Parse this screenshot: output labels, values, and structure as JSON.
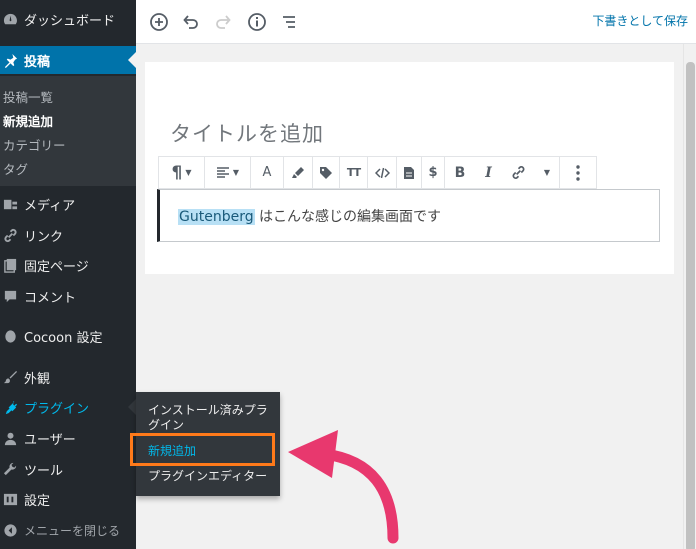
{
  "sidebar": {
    "dashboard": "ダッシュボード",
    "posts": "投稿",
    "posts_sub": [
      "投稿一覧",
      "新規追加",
      "カテゴリー",
      "タグ"
    ],
    "media": "メディア",
    "links": "リンク",
    "pages": "固定ページ",
    "comments": "コメント",
    "cocoon": "Cocoon 設定",
    "appearance": "外観",
    "plugins": "プラグイン",
    "users": "ユーザー",
    "tools": "ツール",
    "settings": "設定",
    "collapse": "メニューを閉じる"
  },
  "flyout": {
    "installed_line1": "インストール済みプラ",
    "installed_line2": "グイン",
    "add_new": "新規追加",
    "editor": "プラグインエディター"
  },
  "topbar": {
    "save_draft": "下書きとして保存"
  },
  "editor": {
    "title_placeholder": "タイトルを追加",
    "paragraph_highlight": "Gutenberg",
    "paragraph_rest": " はこんな感じの編集画面です"
  },
  "block_toolbar": {
    "font_size_icon": "A",
    "bold_icon": "B",
    "italic_icon": "I",
    "dollar_icon": "$",
    "tt_icon": "TT"
  },
  "colors": {
    "sidebar_bg": "#23282d",
    "submenu_bg": "#32373c",
    "accent_blue": "#0073aa",
    "plugin_blue": "#00b9eb",
    "highlight_orange": "#ff7a1a",
    "arrow_pink": "#e8386e"
  }
}
